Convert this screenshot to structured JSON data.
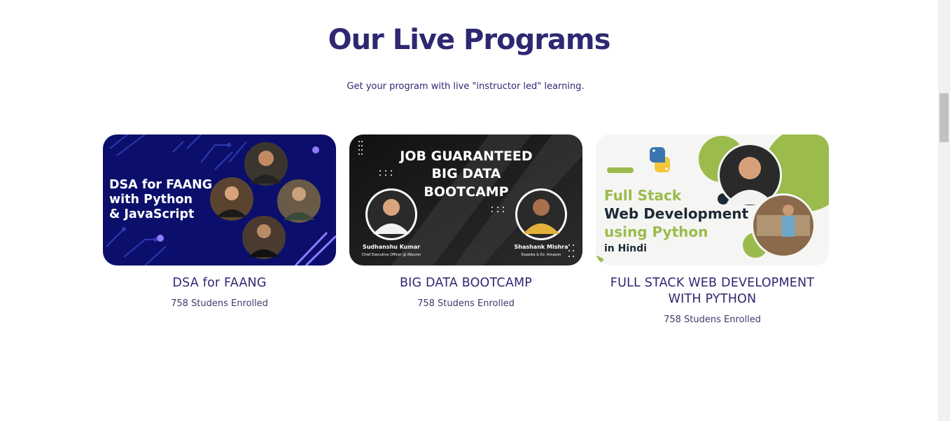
{
  "section": {
    "title": "Our Live Programs",
    "subtitle": "Get your program with live \"instructor led\" learning."
  },
  "programs": [
    {
      "title": "DSA for FAANG",
      "enrolled": "758 Studens Enrolled",
      "banner": {
        "lines": [
          "DSA for FAANG",
          "with Python",
          "& JavaScript"
        ],
        "bg": "#0b0f6b",
        "accent": "#8e7cff"
      }
    },
    {
      "title": "BIG DATA BOOTCAMP",
      "enrolled": "758 Studens Enrolled",
      "banner": {
        "lines": [
          "JOB GUARANTEED",
          "BIG DATA",
          "BOOTCAMP"
        ],
        "instructors": [
          {
            "name": "Sudhanshu Kumar",
            "role": "Chief Executive Officer @ iNeuron"
          },
          {
            "name": "Shashank Mishra",
            "role": "Expedia & Ex- Amazon"
          }
        ],
        "bg": "#1a1a1a"
      }
    },
    {
      "title": "FULL STACK WEB DEVELOPMENT WITH PYTHON",
      "enrolled": "758 Studens Enrolled",
      "banner": {
        "line1": "Full Stack",
        "line2": "Web Development",
        "line3": "using Python",
        "line4": "in Hindi",
        "green": "#9bbb4c",
        "dark": "#1e2a38"
      }
    }
  ],
  "colors": {
    "heading": "#2e2872"
  }
}
